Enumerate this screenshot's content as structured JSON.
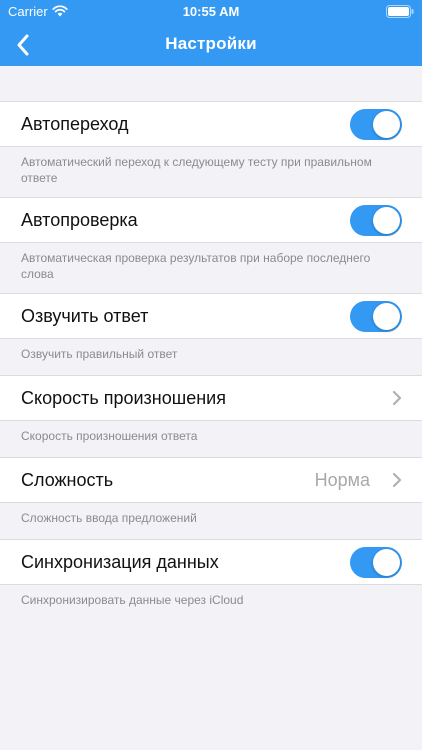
{
  "status_bar": {
    "carrier": "Carrier",
    "time": "10:55 AM"
  },
  "nav": {
    "title": "Настройки",
    "back_icon": "chevron-left-icon"
  },
  "colors": {
    "accent": "#3399F3",
    "background": "#F2F2F7"
  },
  "settings": [
    {
      "label": "Автопереход",
      "control": "toggle",
      "on": true,
      "footnote": "Автоматический переход к следующему тесту при правильном ответе"
    },
    {
      "label": "Автопроверка",
      "control": "toggle",
      "on": true,
      "footnote": "Автоматическая проверка результатов при наборе последнего слова"
    },
    {
      "label": "Озвучить ответ",
      "control": "toggle",
      "on": true,
      "footnote": "Озвучить правильный ответ"
    },
    {
      "label": "Скорость произношения",
      "control": "chevron",
      "footnote": "Скорость произношения ответа"
    },
    {
      "label": "Сложность",
      "control": "chevron",
      "value": "Норма",
      "footnote": "Сложность ввода предложений"
    },
    {
      "label": "Синхронизация данных",
      "control": "toggle",
      "on": true,
      "footnote": "Синхронизировать данные через iCloud"
    }
  ]
}
